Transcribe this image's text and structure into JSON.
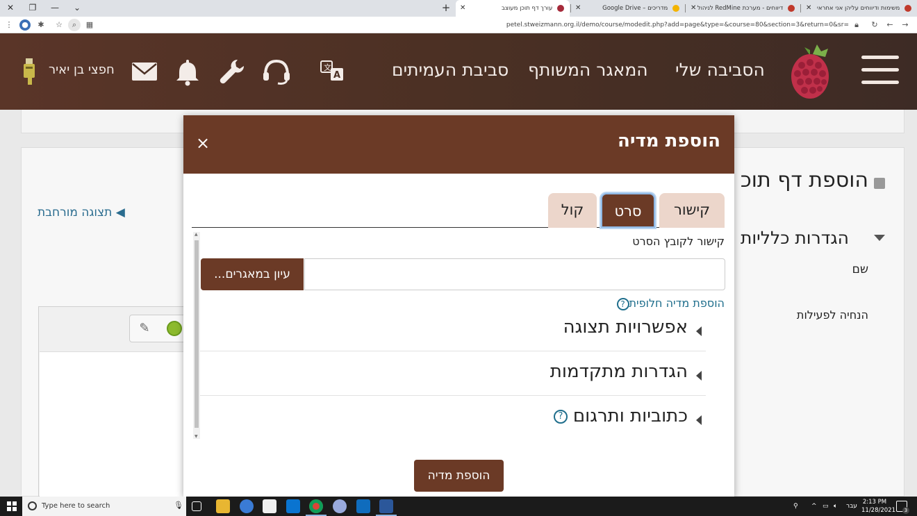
{
  "browser": {
    "tabs": [
      {
        "title": "משימות ודיווחים עליהן אני אחראי"
      },
      {
        "title": "דיווחים - מערכת RedMine לניהול"
      },
      {
        "title": "מדריכים – Google Drive"
      },
      {
        "title": "עורך דף תוכן מעוצב"
      }
    ],
    "url": "petel.stweizmann.org.il/demo/course/modedit.php?add=page&type=&course=80&section=3&return=0&sr="
  },
  "header": {
    "nav": [
      {
        "label": "הסביבה שלי"
      },
      {
        "label": "המאגר המשותף"
      },
      {
        "label": "סביבת העמיתים"
      }
    ],
    "user_name": "חפצי בן יאיר",
    "icons": [
      "menu-icon",
      "translate-icon",
      "support-icon",
      "wrench-icon",
      "bell-icon",
      "mail-icon",
      "usb-icon"
    ],
    "colors": {
      "header": "#4b3024",
      "accent": "#6b3a26",
      "tab_inactive": "#ecd6cb"
    }
  },
  "page": {
    "title": "הוספת דף תוכ",
    "general_settings": "הגדרות כלליות",
    "name_label": "שם",
    "activity_instructions": "הנחיה לפעילות",
    "expanded_view": "תצוגה מורחבת"
  },
  "modal": {
    "title": "הוספת מדיה",
    "close": "×",
    "tabs": [
      {
        "label": "קישור"
      },
      {
        "label": "סרט"
      },
      {
        "label": "קול"
      }
    ],
    "active_tab": "סרט",
    "video_link_label": "קישור לקובץ הסרט",
    "url_value": "",
    "browse_button": "עיון במאגרים...",
    "alt_media_link": "הוספת מדיה חלופית",
    "help_symbol": "?",
    "sections": [
      {
        "label": "אפשרויות תצוגה"
      },
      {
        "label": "הגדרות מתקדמות"
      },
      {
        "label": "כתוביות ותרגום"
      }
    ],
    "submit_button": "הוספת מדיה"
  },
  "taskbar": {
    "search_placeholder": "Type here to search",
    "language": "עבר",
    "time": "2:13 PM",
    "date": "11/28/2021",
    "notifications": "3"
  }
}
